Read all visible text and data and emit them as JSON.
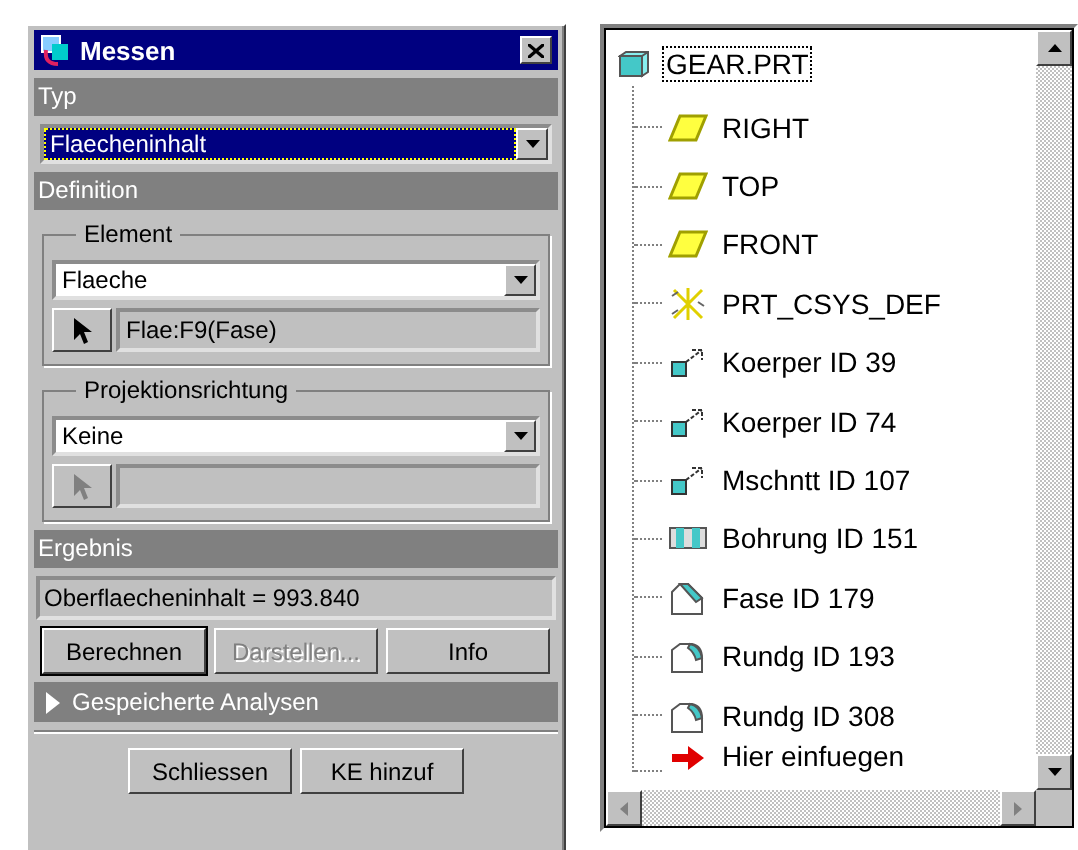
{
  "dialog": {
    "title": "Messen",
    "type_section": {
      "header": "Typ",
      "value": "Flaecheninhalt",
      "focused": true
    },
    "definition": {
      "header": "Definition",
      "groups": [
        {
          "legend": "Element",
          "value": "Flaeche",
          "pick_disabled": false,
          "reference": "Flae:F9(Fase)"
        },
        {
          "legend": "Projektionsrichtung",
          "value": "Keine",
          "pick_disabled": true
        }
      ]
    },
    "result": {
      "header": "Ergebnis",
      "value": "Oberflaecheninhalt = 993.840",
      "buttons": [
        {
          "label": "Berechnen",
          "disabled": false
        },
        {
          "label": "Darstellen...",
          "disabled": true
        },
        {
          "label": "Info",
          "disabled": false
        }
      ]
    },
    "saved": {
      "label": "Gespeicherte Analysen",
      "expanded": false
    },
    "footer_buttons": [
      "Schliessen",
      "KE hinzuf"
    ]
  },
  "model_tree": {
    "root": {
      "label": "GEAR.PRT",
      "kind": "part",
      "selected": true,
      "children": [
        {
          "label": "RIGHT",
          "kind": "plane"
        },
        {
          "label": "TOP",
          "kind": "plane"
        },
        {
          "label": "FRONT",
          "kind": "plane"
        },
        {
          "label": "PRT_CSYS_DEF",
          "kind": "csys"
        },
        {
          "label": "Koerper ID 39",
          "kind": "protrusion"
        },
        {
          "label": "Koerper ID 74",
          "kind": "protrusion"
        },
        {
          "label": "Mschntt ID 107",
          "kind": "protrusion"
        },
        {
          "label": "Bohrung ID 151",
          "kind": "hole"
        },
        {
          "label": "Fase ID 179",
          "kind": "chamfer"
        },
        {
          "label": "Rundg ID 193",
          "kind": "round"
        },
        {
          "label": "Rundg ID 308",
          "kind": "round"
        },
        {
          "label": "Hier einfuegen",
          "kind": "insert"
        }
      ]
    }
  }
}
